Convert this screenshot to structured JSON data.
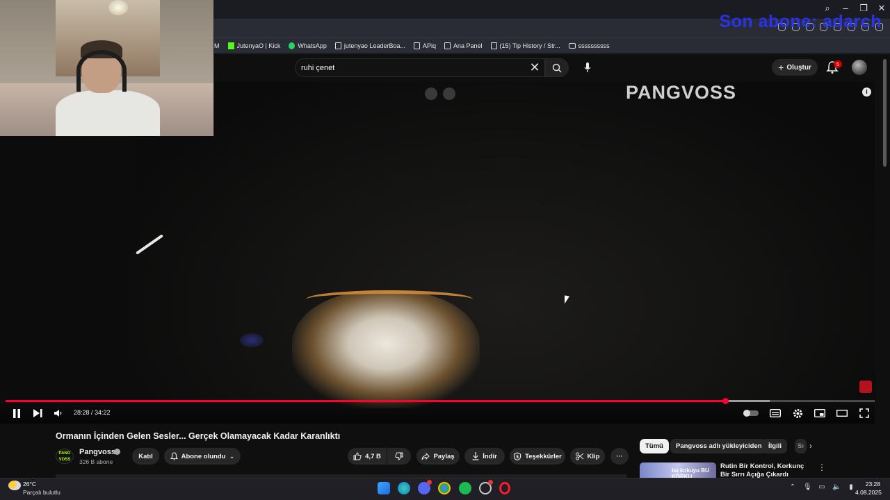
{
  "window": {
    "controls": [
      "⌕",
      "–",
      "❐",
      "✕"
    ]
  },
  "overlay": {
    "text": "Son abone: adarch"
  },
  "bookmarks": [
    {
      "label": "M",
      "icon": "none"
    },
    {
      "label": "JutenyaO | Kick",
      "icon": "kick-icon"
    },
    {
      "label": "WhatsApp",
      "icon": "whatsapp-icon"
    },
    {
      "label": "jutenyao LeaderBoa...",
      "icon": "page-icon"
    },
    {
      "label": "APiq",
      "icon": "page-icon"
    },
    {
      "label": "Ana Panel",
      "icon": "page-icon"
    },
    {
      "label": "(15) Tip History / Str...",
      "icon": "page-icon"
    },
    {
      "label": "ssssssssss",
      "icon": "folder-icon"
    }
  ],
  "youtube": {
    "search_value": "ruhi çenet",
    "create_label": "Oluştur",
    "notification_count": "5"
  },
  "video": {
    "watermark": "PANGVOSS",
    "current_time": "28:28",
    "duration": "34:22",
    "time_display": "28:28 / 34:22",
    "progress_fraction": 0.828,
    "title": "Ormanın İçinden Gelen Sesler... Gerçek Olamayacak Kadar Karanlıktı"
  },
  "channel": {
    "avatar_text": "PANG VOSS",
    "name": "Pangvoss",
    "subscribers": "326 B abone",
    "join_label": "Katıl",
    "subscribed_label": "Abone olundu"
  },
  "actions": {
    "likes": "4,7 B",
    "share": "Paylaş",
    "download": "İndir",
    "thanks": "Teşekkürler",
    "clip": "Klip"
  },
  "chips": [
    {
      "label": "Tümü",
      "selected": true
    },
    {
      "label": "Pangvoss adlı yükleyiciden",
      "selected": false
    },
    {
      "label": "İlgili",
      "selected": false
    },
    {
      "label": "Sı",
      "selected": false
    }
  ],
  "recommendation": {
    "thumb_text": "bu kokuyu BU KORKU",
    "title": "Rutin Bir Kontrol, Korkunç Bir Sırrı Açığa Çıkardı"
  },
  "taskbar": {
    "temperature": "26°C",
    "weather": "Parçalı bulutlu",
    "time": "23:28",
    "date": "4.08.2025"
  },
  "colors": {
    "accent": "#ff0033",
    "overlay_text": "#2a34ff",
    "background": "#0f0f0f"
  }
}
